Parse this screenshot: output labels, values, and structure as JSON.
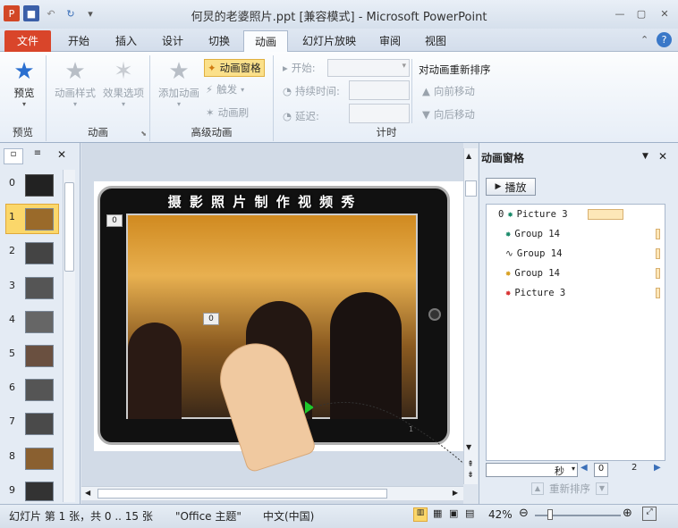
{
  "title": "何炅的老婆照片.ppt [兼容模式] - Microsoft PowerPoint",
  "tabs": [
    "文件",
    "开始",
    "插入",
    "设计",
    "切换",
    "动画",
    "幻灯片放映",
    "审阅",
    "视图"
  ],
  "ribbon": {
    "preview": "预览",
    "preview_group": "预览",
    "anim_style": "动画样式",
    "effect_opts": "效果选项",
    "anim_group": "动画",
    "add_anim": "添加动画",
    "anim_pane": "动画窗格",
    "trigger": "触发",
    "anim_painter": "动画刷",
    "adv_group": "高级动画",
    "start": "开始:",
    "duration": "持续时间:",
    "delay": "延迟:",
    "timing_group": "计时",
    "reorder": "对动画重新排序",
    "move_earlier": "向前移动",
    "move_later": "向后移动"
  },
  "thumbnails": [
    "0",
    "1",
    "2",
    "3",
    "4",
    "5",
    "6",
    "7",
    "8",
    "9"
  ],
  "slide": {
    "banner": "摄 影 照 片 制 作 视 频 秀",
    "tag1": "0",
    "tag2": "0",
    "pagenum": "1"
  },
  "anim_pane": {
    "title": "动画窗格",
    "play": "播放",
    "items": [
      {
        "num": "0",
        "name": "Picture 3",
        "color": "#1a8a6a"
      },
      {
        "num": "",
        "name": "Group 14",
        "color": "#1a8a6a"
      },
      {
        "num": "",
        "name": "Group 14",
        "color": "#333333"
      },
      {
        "num": "",
        "name": "Group 14",
        "color": "#d8a020"
      },
      {
        "num": "",
        "name": "Picture 3",
        "color": "#d83030"
      }
    ],
    "seconds": "秒",
    "timeline_0": "0",
    "timeline_2": "2",
    "reorder": "重新排序"
  },
  "status": {
    "slide": "幻灯片 第 1 张，共 0 .. 15 张",
    "theme": "\"Office 主题\"",
    "lang": "中文(中国)",
    "zoom": "42%"
  }
}
